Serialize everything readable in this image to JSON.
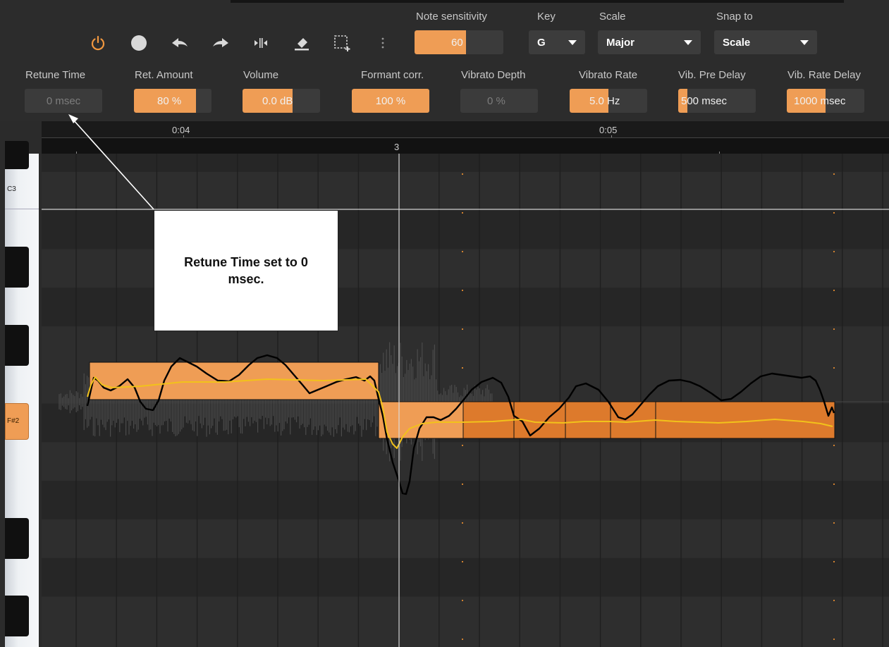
{
  "toolbar": {
    "icons": [
      "power-icon",
      "record-icon",
      "undo-icon",
      "redo-icon",
      "split-icon",
      "eraser-icon",
      "selection-add-icon",
      "more-icon"
    ],
    "note_sensitivity": {
      "label": "Note sensitivity",
      "value": "60",
      "level": 0.6
    },
    "key": {
      "label": "Key",
      "value": "G"
    },
    "scale": {
      "label": "Scale",
      "value": "Major"
    },
    "snap": {
      "label": "Snap to",
      "value": "Scale"
    }
  },
  "params": {
    "retune_time": {
      "label": "Retune Time",
      "value": "0 msec",
      "level": 0
    },
    "ret_amount": {
      "label": "Ret. Amount",
      "value": "80 %",
      "level": 0.8
    },
    "volume": {
      "label": "Volume",
      "value": "0.0 dB",
      "level": 0.5
    },
    "formant": {
      "label": "Formant corr.",
      "value": "100 %",
      "level": 1.0
    },
    "vib_depth": {
      "label": "Vibrato Depth",
      "value": "0 %",
      "level": 0
    },
    "vib_rate": {
      "label": "Vibrato Rate",
      "value": "5.0 Hz",
      "level": 0.5
    },
    "vib_pre_delay": {
      "label": "Vib. Pre Delay",
      "value": "500 msec",
      "level": 0.12
    },
    "vib_rate_delay": {
      "label": "Vib. Rate Delay",
      "value": "1000 msec",
      "level": 0.5
    }
  },
  "timeline": {
    "time_a": "0:04",
    "time_b": "0:05",
    "bar": "3"
  },
  "piano": {
    "c3": "C3",
    "fs2": "F#2"
  },
  "callout": {
    "text": "Retune Time set to 0 msec."
  },
  "colors": {
    "accent": "#ef9d55",
    "note_dark": "#dd7a2c",
    "pitch_curve": "#f2c21a",
    "raw_pitch": "#000000"
  }
}
